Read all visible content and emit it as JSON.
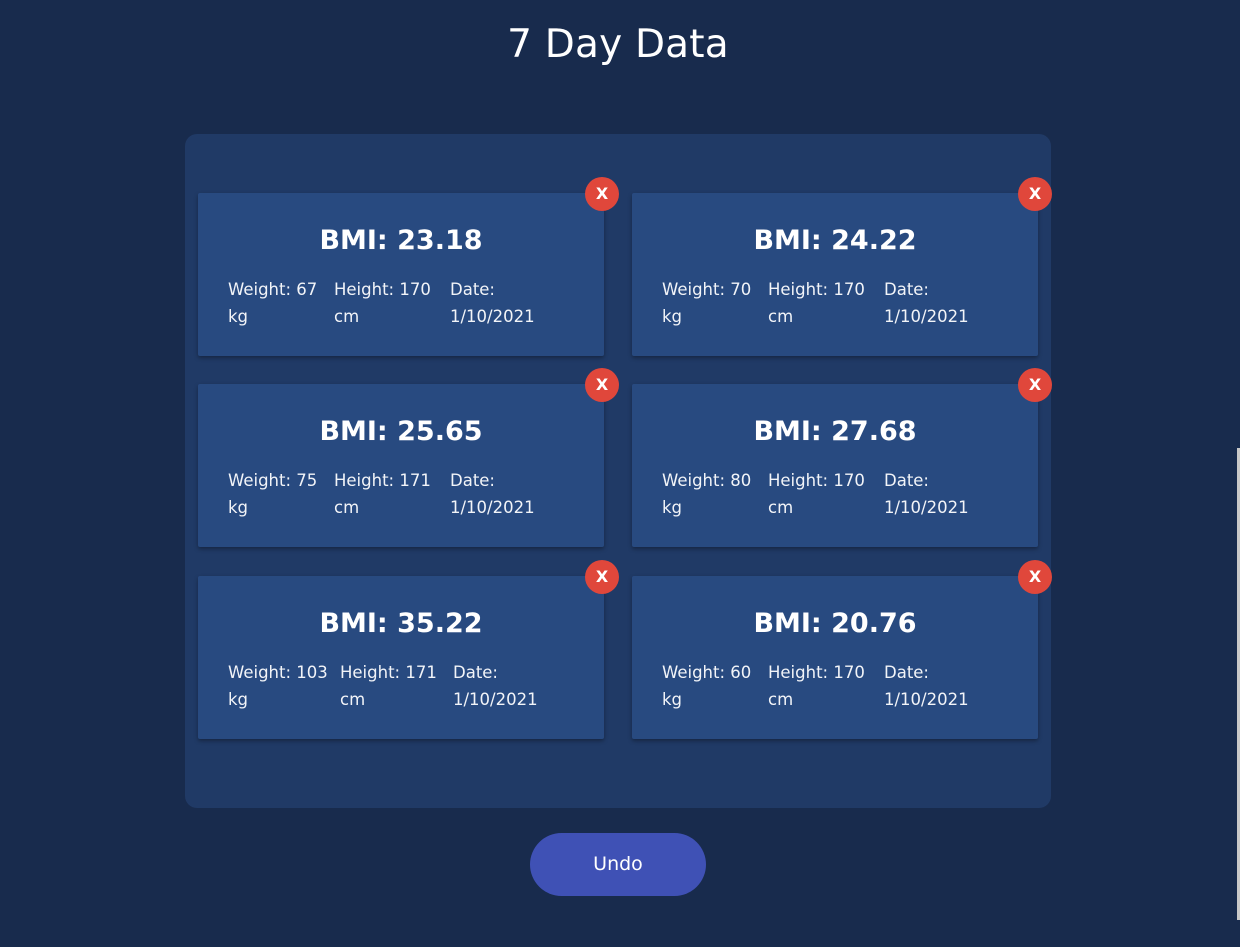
{
  "page": {
    "title": "7 Day Data"
  },
  "records": [
    {
      "bmi": "BMI: 23.18",
      "weight": "Weight: 67",
      "weight_unit": "kg",
      "height": "Height: 170",
      "height_unit": "cm",
      "date_label": "Date:",
      "date": "1/10/2021",
      "remove_label": "X"
    },
    {
      "bmi": "BMI: 24.22",
      "weight": "Weight: 70",
      "weight_unit": "kg",
      "height": "Height: 170",
      "height_unit": "cm",
      "date_label": "Date:",
      "date": "1/10/2021",
      "remove_label": "X"
    },
    {
      "bmi": "BMI: 25.65",
      "weight": "Weight: 75",
      "weight_unit": "kg",
      "height": "Height: 171",
      "height_unit": "cm",
      "date_label": "Date:",
      "date": "1/10/2021",
      "remove_label": "X"
    },
    {
      "bmi": "BMI: 27.68",
      "weight": "Weight: 80",
      "weight_unit": "kg",
      "height": "Height: 170",
      "height_unit": "cm",
      "date_label": "Date:",
      "date": "1/10/2021",
      "remove_label": "X"
    },
    {
      "bmi": "BMI: 35.22",
      "weight": "Weight: 103",
      "weight_unit": "kg",
      "height": "Height: 171",
      "height_unit": "cm",
      "date_label": "Date:",
      "date": "1/10/2021",
      "remove_label": "X"
    },
    {
      "bmi": "BMI: 20.76",
      "weight": "Weight: 60",
      "weight_unit": "kg",
      "height": "Height: 170",
      "height_unit": "cm",
      "date_label": "Date:",
      "date": "1/10/2021",
      "remove_label": "X"
    }
  ],
  "actions": {
    "undo_label": "Undo"
  },
  "colors": {
    "background": "#182b4d",
    "panel": "#203a66",
    "card": "#284a80",
    "remove_button": "#e0473b",
    "undo_button": "#3f51b5"
  }
}
